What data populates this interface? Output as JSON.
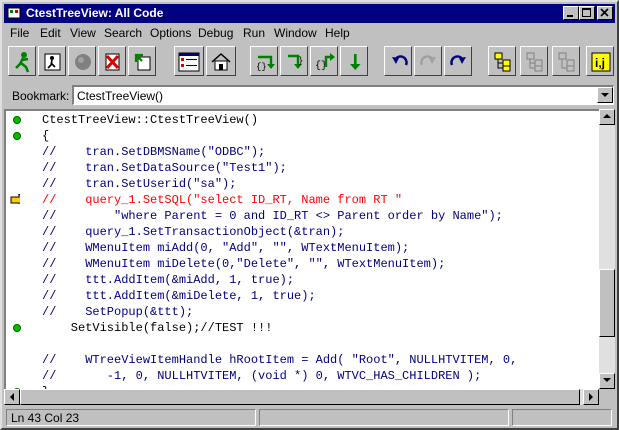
{
  "window": {
    "title": "CtestTreeView: All Code"
  },
  "menu": [
    "File",
    "Edit",
    "View",
    "Search",
    "Options",
    "Debug",
    "Run",
    "Window",
    "Help"
  ],
  "toolbar": {
    "tools": [
      "run-icon",
      "step-person-icon",
      "gray-circle-icon",
      "stop-icon",
      "exit-icon",
      "breakpoint-list-icon",
      "home-icon",
      "step-into-icon",
      "step-over-icon",
      "step-out-icon",
      "run-to-cursor-icon",
      "undo-icon",
      "redo-icon",
      "redo-alt-icon",
      "tree-view-icon",
      "tree-collapse-icon",
      "tree-expand-icon",
      "ij-icon"
    ]
  },
  "bookmark": {
    "label": "Bookmark:",
    "value": "CtestTreeView()"
  },
  "code": {
    "lines": [
      {
        "text": "CtestTreeView::CtestTreeView()",
        "marker": "dot",
        "style": "normal"
      },
      {
        "text": "{",
        "marker": "dot",
        "style": "normal"
      },
      {
        "text": "//    tran.SetDBMSName(\"ODBC\");",
        "marker": "",
        "style": "comment"
      },
      {
        "text": "//    tran.SetDataSource(\"Test1\");",
        "marker": "",
        "style": "comment"
      },
      {
        "text": "//    tran.SetUserid(\"sa\");",
        "marker": "",
        "style": "comment"
      },
      {
        "text": "//    query_1.SetSQL(\"select ID_RT, Name from RT \"",
        "marker": "arrow",
        "style": "current"
      },
      {
        "text": "//        \"where Parent = 0 and ID_RT <> Parent order by Name\");",
        "marker": "",
        "style": "comment"
      },
      {
        "text": "//    query_1.SetTransactionObject(&tran);",
        "marker": "",
        "style": "comment"
      },
      {
        "text": "//    WMenuItem miAdd(0, \"Add\", \"\", WTextMenuItem);",
        "marker": "",
        "style": "comment"
      },
      {
        "text": "//    WMenuItem miDelete(0,\"Delete\", \"\", WTextMenuItem);",
        "marker": "",
        "style": "comment"
      },
      {
        "text": "//    ttt.AddItem(&miAdd, 1, true);",
        "marker": "",
        "style": "comment"
      },
      {
        "text": "//    ttt.AddItem(&miDelete, 1, true);",
        "marker": "",
        "style": "comment"
      },
      {
        "text": "//    SetPopup(&ttt);",
        "marker": "",
        "style": "comment"
      },
      {
        "text": "    SetVisible(false);//TEST !!!",
        "marker": "dot",
        "style": "normal"
      },
      {
        "text": "",
        "marker": "",
        "style": "normal"
      },
      {
        "text": "//    WTreeViewItemHandle hRootItem = Add( \"Root\", NULLHTVITEM, 0,",
        "marker": "",
        "style": "comment"
      },
      {
        "text": "//       -1, 0, NULLHTVITEM, (void *) 0, WTVC_HAS_CHILDREN );",
        "marker": "",
        "style": "comment"
      },
      {
        "text": "}",
        "marker": "dot",
        "style": "normal"
      }
    ]
  },
  "status": {
    "position": "Ln 43 Col 23",
    "panel2": "",
    "panel3": ""
  },
  "colors": {
    "comment": "#000080",
    "current": "#ff0000",
    "normal": "#000000",
    "title_bg": "#000080"
  }
}
